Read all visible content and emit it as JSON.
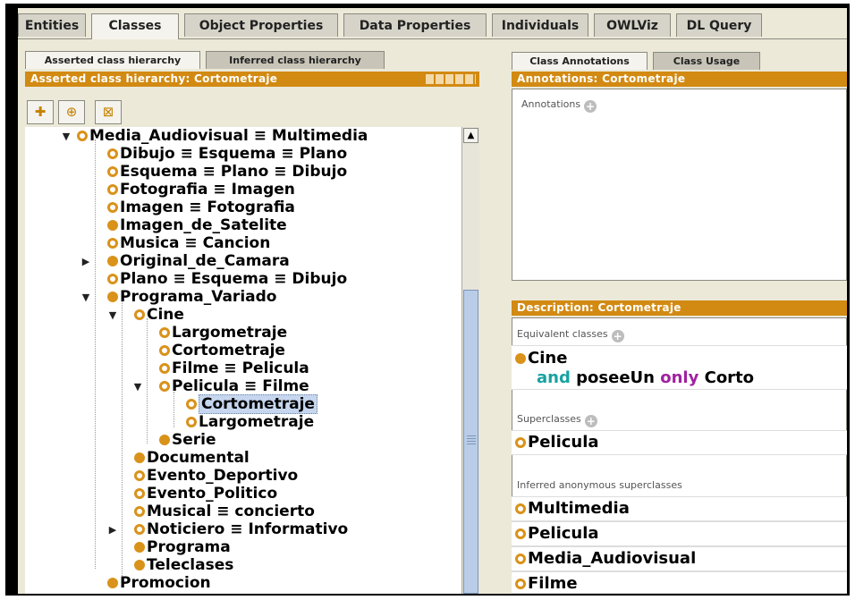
{
  "top_tabs": [
    "Entities",
    "Classes",
    "Object Properties",
    "Data Properties",
    "Individuals",
    "OWLViz",
    "DL Query"
  ],
  "left_subtabs": [
    "Asserted class hierarchy",
    "Inferred class hierarchy"
  ],
  "left_header": "Asserted class hierarchy: Cortometraje",
  "toolbar_icons": [
    "add-subclass-icon",
    "add-sibling-icon",
    "delete-class-icon"
  ],
  "tree": [
    {
      "label": "Media_Audiovisual ≡ Multimedia"
    },
    {
      "label": "Dibujo ≡ Esquema ≡ Plano"
    },
    {
      "label": "Esquema ≡ Plano ≡ Dibujo"
    },
    {
      "label": "Fotografia ≡ Imagen"
    },
    {
      "label": "Imagen ≡ Fotografia"
    },
    {
      "label": "Imagen_de_Satelite"
    },
    {
      "label": "Musica ≡ Cancion"
    },
    {
      "label": "Original_de_Camara"
    },
    {
      "label": "Plano ≡ Esquema ≡ Dibujo"
    },
    {
      "label": "Programa_Variado"
    },
    {
      "label": "Cine"
    },
    {
      "label": "Largometraje"
    },
    {
      "label": "Cortometraje"
    },
    {
      "label": "Filme ≡ Pelicula"
    },
    {
      "label": "Pelicula ≡ Filme"
    },
    {
      "label": "Cortometraje"
    },
    {
      "label": "Largometraje"
    },
    {
      "label": "Serie"
    },
    {
      "label": "Documental"
    },
    {
      "label": "Evento_Deportivo"
    },
    {
      "label": "Evento_Politico"
    },
    {
      "label": "Musical ≡ concierto"
    },
    {
      "label": "Noticiero ≡ Informativo"
    },
    {
      "label": "Programa"
    },
    {
      "label": "Teleclases"
    },
    {
      "label": "Promocion"
    }
  ],
  "right_subtabs": [
    "Class Annotations",
    "Class Usage"
  ],
  "annotations_header": "Annotations: Cortometraje",
  "annotations_label": "Annotations",
  "description_header": "Description: Cortometraje",
  "equivalent_label": "Equivalent classes",
  "equivalent_line1": "Cine",
  "equivalent_and": "and",
  "equivalent_prop": "poseeUn",
  "equivalent_only": "only",
  "equivalent_filler": "Corto",
  "superclasses_label": "Superclasses",
  "superclasses": [
    "Pelicula"
  ],
  "inferred_label": "Inferred anonymous superclasses",
  "inferred": [
    "Multimedia",
    "Pelicula",
    "Media_Audiovisual",
    "Filme"
  ],
  "colors": {
    "header": "#d28a12",
    "class_dot": "#d9921a",
    "selection": "#c6d6ee",
    "and_keyword": "#17a2a2",
    "only_keyword": "#a020a0"
  }
}
